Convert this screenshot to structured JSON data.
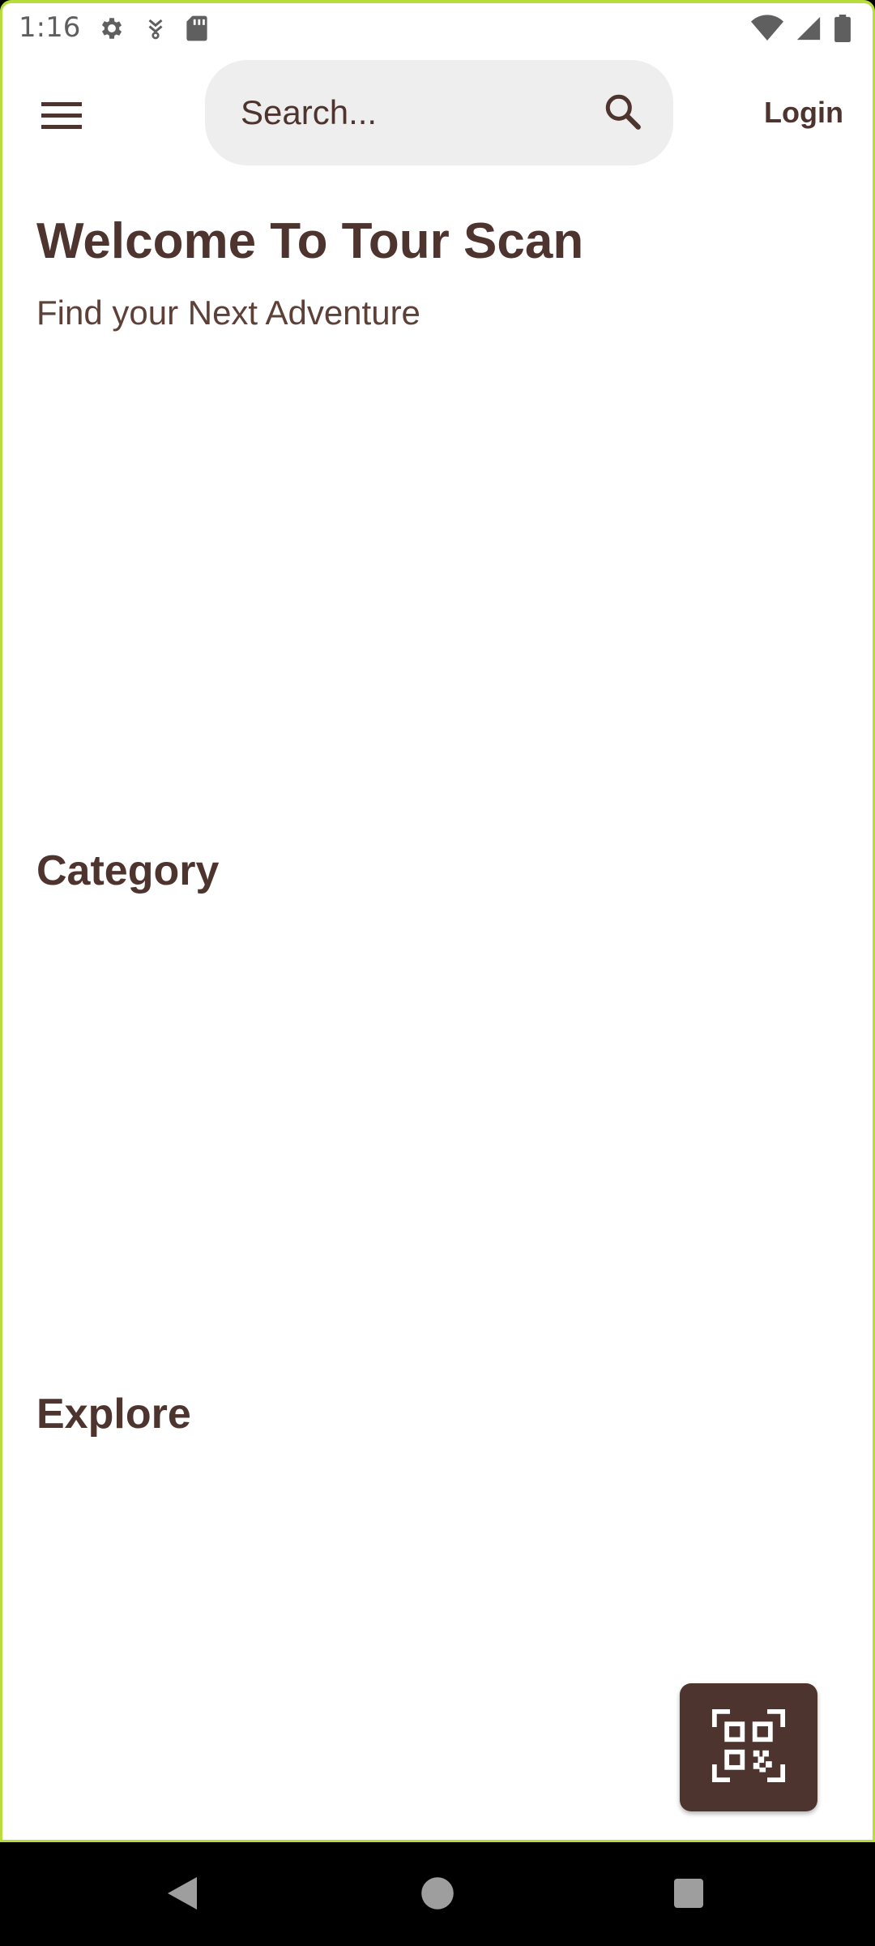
{
  "status_bar": {
    "time": "1:16",
    "icons_left": [
      "settings-icon",
      "download-icon",
      "sd-card-icon"
    ],
    "icons_right": [
      "wifi-icon",
      "signal-icon",
      "battery-icon"
    ]
  },
  "app_bar": {
    "menu_icon": "hamburger-menu-icon",
    "search_placeholder": "Search...",
    "search_icon": "search-icon",
    "login_label": "Login"
  },
  "main": {
    "title": "Welcome To Tour Scan",
    "subtitle": "Find your Next Adventure",
    "category_heading": "Category",
    "explore_heading": "Explore"
  },
  "fab": {
    "icon": "qr-code-scan-icon"
  },
  "nav_bar": {
    "back_icon": "back-triangle-icon",
    "home_icon": "home-circle-icon",
    "recents_icon": "recents-square-icon"
  },
  "colors": {
    "primary_brown": "#4e342e",
    "secondary_brown": "#5d4037",
    "search_bg": "#eeeeee",
    "frame_accent": "#b7dd3a",
    "nav_bar_bg": "#000000"
  }
}
